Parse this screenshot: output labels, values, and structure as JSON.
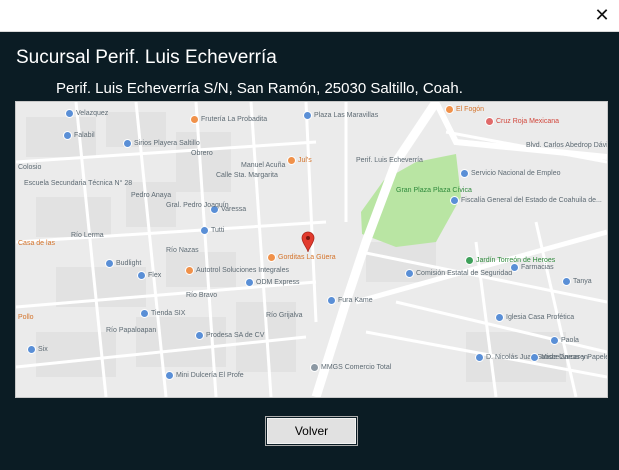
{
  "window": {
    "close_glyph": "✕"
  },
  "branch": {
    "title": "Sucursal Perif. Luis Echeverría",
    "address": "Perif. Luis Echeverría S/N, San Ramón, 25030 Saltillo, Coah."
  },
  "map": {
    "labels": [
      {
        "text": "Velazquez",
        "cls": ""
      },
      {
        "text": "Frutería La Probadita",
        "cls": ""
      },
      {
        "text": "Falabil",
        "cls": ""
      },
      {
        "text": "Sirios Playera Saltillo",
        "cls": ""
      },
      {
        "text": "Plaza Las Maravillas",
        "cls": ""
      },
      {
        "text": "Jul's",
        "cls": "orange"
      },
      {
        "text": "Perif. Luis Echeverría",
        "cls": ""
      },
      {
        "text": "El Fogón",
        "cls": "orange"
      },
      {
        "text": "Cruz Roja Mexicana",
        "cls": "red"
      },
      {
        "text": "Blvd. Carlos Abedrop Dávila",
        "cls": ""
      },
      {
        "text": "Servicio Nacional de Empleo",
        "cls": ""
      },
      {
        "text": "Fiscalía General del Estado de Coahuila de...",
        "cls": ""
      },
      {
        "text": "Gran Plaza Plaza Cívica",
        "cls": "green"
      },
      {
        "text": "Escuela Secundaria Técnica N° 28",
        "cls": ""
      },
      {
        "text": "Colosio",
        "cls": ""
      },
      {
        "text": "Tutti",
        "cls": ""
      },
      {
        "text": "Casa de las",
        "cls": "orange"
      },
      {
        "text": "Budlight",
        "cls": ""
      },
      {
        "text": "Flex",
        "cls": ""
      },
      {
        "text": "Autotrol Soluciones Integrales",
        "cls": ""
      },
      {
        "text": "Gorditas La Güera",
        "cls": "orange"
      },
      {
        "text": "ODM Express",
        "cls": ""
      },
      {
        "text": "Jardín Torreón de Heroes",
        "cls": "green"
      },
      {
        "text": "Comisión Estatal de Seguridad",
        "cls": ""
      },
      {
        "text": "Farmacias",
        "cls": ""
      },
      {
        "text": "Tanya",
        "cls": ""
      },
      {
        "text": "Fura Kame",
        "cls": ""
      },
      {
        "text": "Iglesia Casa Profética",
        "cls": ""
      },
      {
        "text": "Tienda SIX",
        "cls": ""
      },
      {
        "text": "Prodesa SA de CV",
        "cls": ""
      },
      {
        "text": "Paola",
        "cls": ""
      },
      {
        "text": "Six",
        "cls": ""
      },
      {
        "text": "Pollo",
        "cls": "orange"
      },
      {
        "text": "Mini Dulcería El Profe",
        "cls": ""
      },
      {
        "text": "MMGS Comercio Total",
        "cls": ""
      },
      {
        "text": "D. Nicolás Juan Saade Carcaren",
        "cls": ""
      },
      {
        "text": "Misceláneas y Papelería Paloma",
        "cls": ""
      },
      {
        "text": "Varessa",
        "cls": ""
      },
      {
        "text": "Obrero",
        "cls": ""
      },
      {
        "text": "Río Lerma",
        "cls": ""
      },
      {
        "text": "Río Bravo",
        "cls": ""
      },
      {
        "text": "Río Nazas",
        "cls": ""
      },
      {
        "text": "Río Grijalva",
        "cls": ""
      },
      {
        "text": "Río Papaloapan",
        "cls": ""
      },
      {
        "text": "Calle Sta. Margarita",
        "cls": ""
      },
      {
        "text": "Pedro Anaya",
        "cls": ""
      },
      {
        "text": "Manuel Acuña",
        "cls": ""
      },
      {
        "text": "Gral. Pedro Joaquín",
        "cls": ""
      }
    ]
  },
  "button": {
    "label": "Volver"
  }
}
